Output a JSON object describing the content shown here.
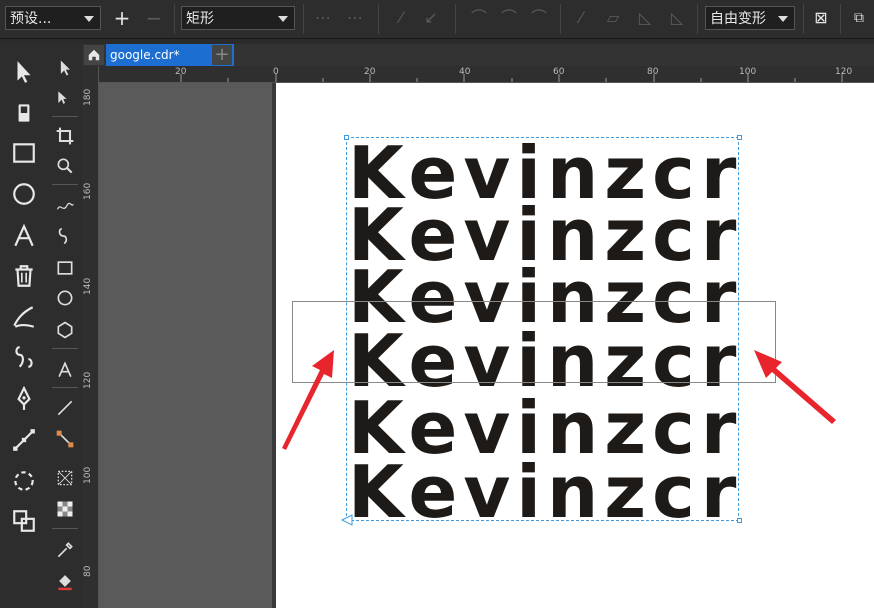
{
  "propbar": {
    "preset_label": "预设...",
    "shape_label": "矩形",
    "transform_label": "自由变形"
  },
  "tabs": {
    "active_tab": "google.cdr*"
  },
  "ruler": {
    "h_labels": [
      "20",
      "0",
      "20",
      "40",
      "60",
      "80",
      "100",
      "120"
    ],
    "v_labels": [
      "180",
      "160",
      "140",
      "120",
      "100",
      "80"
    ]
  },
  "canvas": {
    "text_lines": [
      "Kevinzcr",
      "Kevinzcr",
      "Kevinzcr",
      "Kevinzcr",
      "Kevinzcr",
      "Kevinzcr"
    ],
    "text_color": "#1e1a17",
    "selection_color": "#3c9be0",
    "arrow_color": "#e8242c"
  },
  "toolbox": {
    "tools": [
      "pick-tool-icon",
      "shape-tool-icon",
      "rectangle-tool-icon",
      "ellipse-tool-icon",
      "text-tool-icon",
      "delete-icon",
      "artistic-media-icon",
      "freehand-tool-icon",
      "pen-tool-icon",
      "connector-tool-icon",
      "blend-tool-icon",
      "weld-icon"
    ]
  },
  "toolbox2": {
    "tools": [
      "pick-icon",
      "node-edit-icon",
      "crop-icon",
      "zoom-icon",
      "freehand-icon",
      "bspline-icon",
      "rectangle-icon",
      "ellipse-icon",
      "polygon-icon",
      "text-icon",
      "dimension-icon",
      "connector-icon",
      "envelope-icon",
      "transparency-icon",
      "eyedropper-icon",
      "fill-icon"
    ]
  }
}
